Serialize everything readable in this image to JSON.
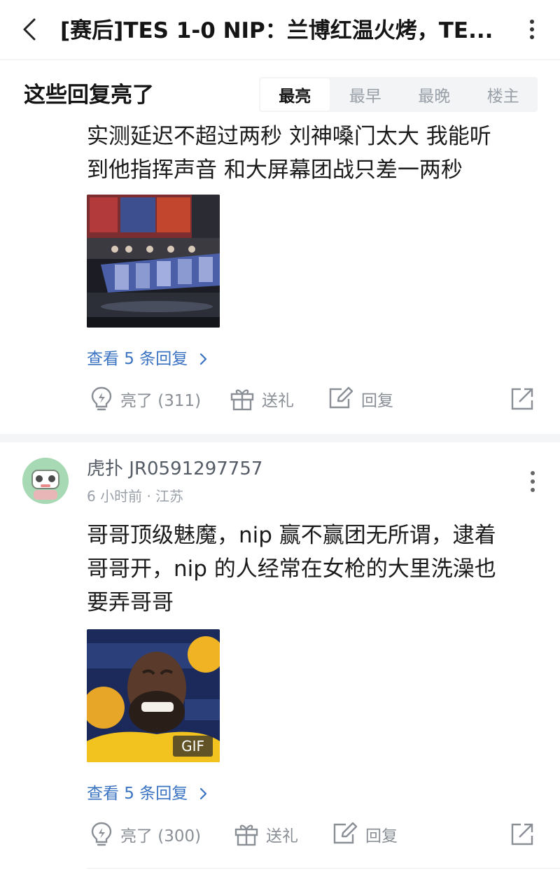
{
  "header": {
    "title": "[赛后]TES 1-0 NIP：兰博红温火烤，TE...",
    "back_icon": "chevron-left-icon",
    "more_icon": "more-vertical-icon"
  },
  "section": {
    "title": "这些回复亮了",
    "tabs": [
      {
        "label": "最亮",
        "active": true
      },
      {
        "label": "最早",
        "active": false
      },
      {
        "label": "最晚",
        "active": false
      },
      {
        "label": "楼主",
        "active": false
      }
    ]
  },
  "comments": [
    {
      "text_lines": [
        "实测延迟不超过两秒 刘神嗓门太大 我能听",
        "到他指挥声音 和大屏幕团战只差一两秒"
      ],
      "image_alt": "stage photo",
      "view_replies": "查看 5 条回复",
      "actions": {
        "like": "亮了 (311)",
        "gift": "送礼",
        "reply": "回复"
      }
    },
    {
      "username": "虎扑 JR0591297757",
      "meta": "6 小时前 · 江苏",
      "text_lines": [
        "哥哥顶级魅魔，nip 赢不赢团无所谓，逮着",
        "哥哥开，nip 的人经常在女枪的大里洗澡也",
        "要弄哥哥"
      ],
      "gif_label": "GIF",
      "view_replies": "查看 5 条回复",
      "actions": {
        "like": "亮了 (300)",
        "gift": "送礼",
        "reply": "回复"
      }
    }
  ],
  "colors": {
    "link_blue": "#3a73c2",
    "muted_gray": "#8a8f96",
    "tab_bg": "#f3f4f6"
  }
}
